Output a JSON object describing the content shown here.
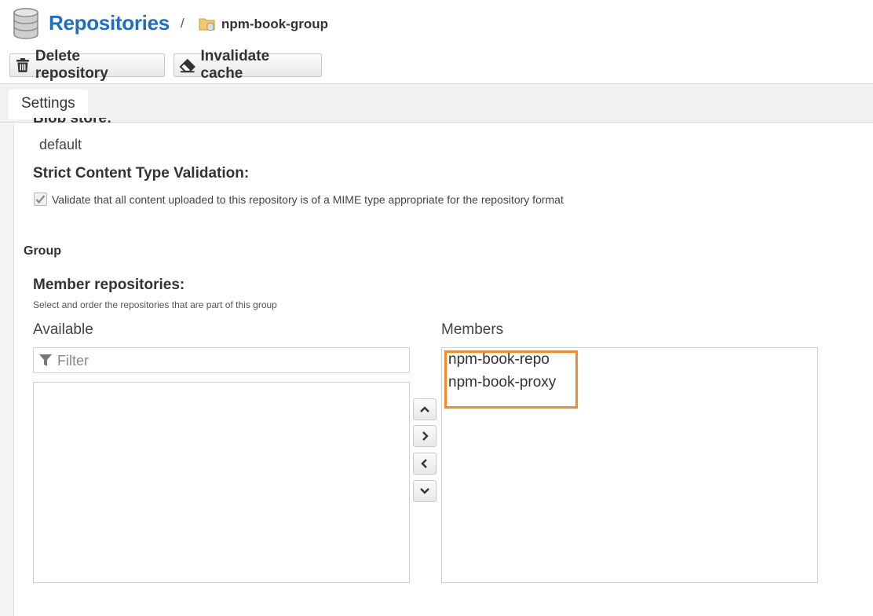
{
  "header": {
    "title": "Repositories",
    "separator": "/",
    "breadcrumb": "npm-book-group"
  },
  "toolbar": {
    "delete_label": "Delete repository",
    "invalidate_label": "Invalidate cache"
  },
  "tabs": [
    {
      "label": "Settings",
      "active": true
    }
  ],
  "settings": {
    "blob_store_label": "Blob store:",
    "blob_store_value": "default",
    "strict_label": "Strict Content Type Validation:",
    "strict_checkbox_text": "Validate that all content uploaded to this repository is of a MIME type appropriate for the repository format",
    "strict_checked": true
  },
  "group": {
    "heading": "Group",
    "member_label": "Member repositories:",
    "help_text": "Select and order the repositories that are part of this group",
    "available_label": "Available",
    "filter_placeholder": "Filter",
    "members_label": "Members",
    "members": [
      "npm-book-repo",
      "npm-book-proxy"
    ]
  },
  "icons": {
    "database": "database-icon",
    "folder": "folder-icon",
    "trash": "trash-icon",
    "eraser": "eraser-icon",
    "filter": "filter-icon",
    "up": "chevron-up-icon",
    "right": "chevron-right-icon",
    "left": "chevron-left-icon",
    "down": "chevron-down-icon"
  },
  "colors": {
    "title": "#1f6ec0",
    "highlight": "#f28a2e"
  }
}
